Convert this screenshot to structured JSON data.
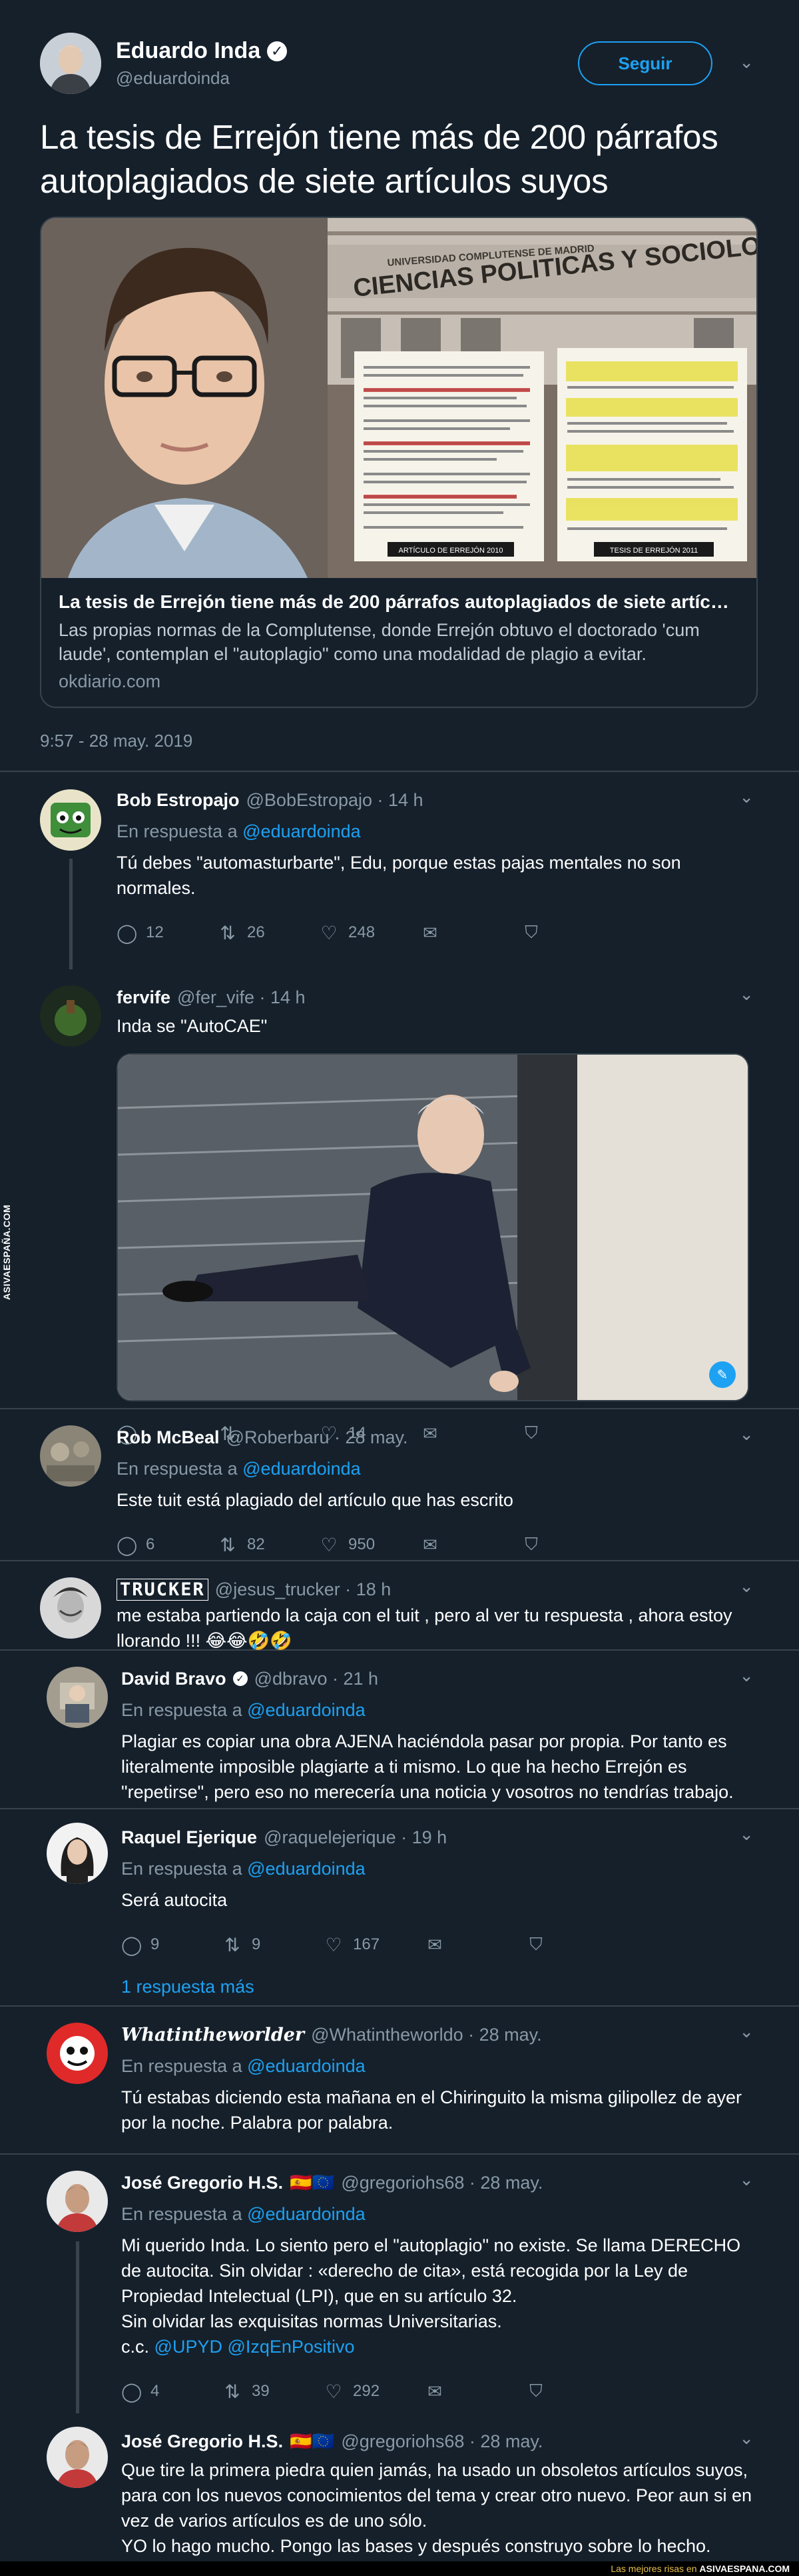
{
  "main_tweet": {
    "name": "Eduardo Inda",
    "handle": "@eduardoinda",
    "follow_label": "Seguir",
    "text": "La tesis de Errejón tiene más de 200 párrafos autoplagiados de siete artículos suyos",
    "card": {
      "sign_top": "UNIVERSIDAD COMPLUTENSE DE MADRID",
      "sign_main": "CIENCIAS POLITICAS Y SOCIOLOGIA",
      "doc_left_caption": "ARTÍCULO DE ERREJÓN 2010",
      "doc_right_caption": "TESIS DE ERREJÓN 2011",
      "title": "La tesis de Errejón tiene más de 200 párrafos autoplagiados de siete artículo…",
      "description": "Las propias normas de la Complutense, donde Errejón obtuvo el doctorado 'cum laude', contemplan el \"autoplagio\" como una modalidad de plagio a evitar.",
      "domain": "okdiario.com"
    },
    "timestamp": "9:57 - 28 may. 2019"
  },
  "replies": [
    {
      "name": "Bob Estropajo",
      "meta": "@BobEstropajo · 14 h",
      "in_reply_prefix": "En respuesta a",
      "in_reply_to": "@eduardoinda",
      "text": "Tú debes \"automasturbarte\", Edu, porque estas pajas mentales no son normales.",
      "replies": "12",
      "retweets": "26",
      "likes": "248"
    },
    {
      "name": "fervife",
      "meta": "@fer_vife · 14 h",
      "text": "Inda se \"AutoCAE\"",
      "replies": "",
      "retweets": "",
      "likes": "14"
    },
    {
      "name": "Rob McBeal",
      "meta": "@Roberbaru · 28 may.",
      "in_reply_prefix": "En respuesta a",
      "in_reply_to": "@eduardoinda",
      "text": "Este tuit está plagiado del artículo que has escrito",
      "replies": "6",
      "retweets": "82",
      "likes": "950"
    },
    {
      "name": "TRUCKER",
      "meta": "@jesus_trucker · 18 h",
      "text": "me estaba partiendo la caja con el tuit , pero al ver tu respuesta , ahora estoy llorando !!! 😂😂🤣🤣"
    },
    {
      "name": "David Bravo",
      "meta": "@dbravo · 21 h",
      "in_reply_prefix": "En respuesta a",
      "in_reply_to": "@eduardoinda",
      "text": "Plagiar es copiar una obra AJENA haciéndola pasar por propia. Por tanto es literalmente imposible plagiarte a ti mismo. Lo que ha hecho Errejón es \"repetirse\", pero eso no merecería una noticia y vosotros no tendrías trabajo."
    },
    {
      "name": "Raquel Ejerique",
      "meta": "@raquelejerique · 19 h",
      "text": "Será autocita",
      "replies": "9",
      "retweets": "9",
      "likes": "167",
      "more_label": "1 respuesta más"
    },
    {
      "name": "Whatintheworlder",
      "meta": "@Whatintheworldo · 28 may.",
      "in_reply_prefix": "En respuesta a",
      "in_reply_to": "@eduardoinda",
      "text": "Tú estabas diciendo esta mañana en el Chiringuito la misma gilipollez de ayer por la noche. Palabra por palabra."
    },
    {
      "name": "José Gregorio H.S.",
      "flags": "🇪🇸🇪🇺",
      "meta": "@gregoriohs68 · 28 may.",
      "in_reply_prefix": "En respuesta a",
      "in_reply_to": "@eduardoinda",
      "text_lines": [
        "Mi querido Inda. Lo siento pero el \"autoplagio\" no existe. Se llama DERECHO de autocita. Sin olvidar : «derecho de cita», está recogida por la Ley de Propiedad Intelectual (LPI), que en su artículo 32.",
        "Sin olvidar las exquisitas normas Universitarias."
      ],
      "cc_prefix": "c.c.",
      "cc_links": [
        "@UPYD",
        "@IzqEnPositivo"
      ],
      "replies": "4",
      "retweets": "39",
      "likes": "292"
    },
    {
      "name": "José Gregorio H.S.",
      "flags": "🇪🇸🇪🇺",
      "meta": "@gregoriohs68 · 28 may.",
      "text_lines": [
        "Que tire la primera piedra quien jamás, ha usado un obsoletos artículos suyos, para con los nuevos conocimientos del tema y crear otro nuevo. Peor aun si en vez de varios artículos es de uno sólo.",
        "YO lo hago mucho. Pongo las bases y después construyo sobre lo hecho. Autoplagio? 💩"
      ]
    }
  ],
  "watermark": {
    "side_text": "ASIVAESPAÑA.COM",
    "footer_prefix": "Las mejores risas en",
    "footer_brand": "ASIVAESPANA.COM"
  },
  "icons": {
    "reply": "speech-bubble-icon",
    "retweet": "retweet-icon",
    "like": "heart-icon",
    "dm": "envelope-icon",
    "analytics": "shield-chevron-icon"
  },
  "colors": {
    "background": "#15202b",
    "accent": "#1da1f2",
    "muted": "#8899a6",
    "divider": "#38444d"
  }
}
